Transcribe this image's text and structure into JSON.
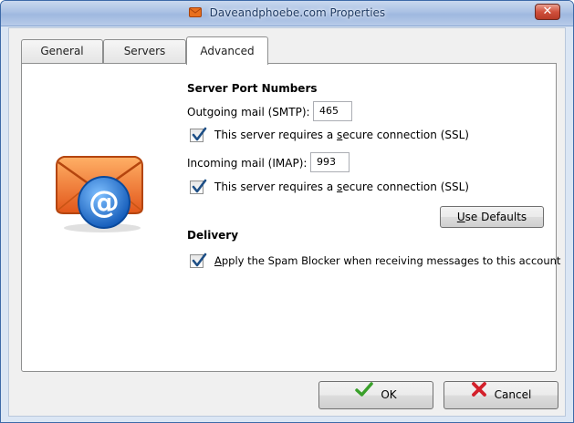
{
  "window": {
    "title": "Daveandphoebe.com Properties",
    "close_glyph": "✕"
  },
  "tabs": [
    {
      "label": "General",
      "active": false
    },
    {
      "label": "Servers",
      "active": false
    },
    {
      "label": "Advanced",
      "active": true
    }
  ],
  "server_ports": {
    "heading": "Server Port Numbers",
    "outgoing": {
      "label": "Outgoing mail (SMTP):",
      "value": "465",
      "ssl_pre": "This server requires a ",
      "ssl_key": "s",
      "ssl_post": "ecure connection (SSL)",
      "ssl_checked": true
    },
    "incoming": {
      "label": "Incoming mail (IMAP):",
      "value": "993",
      "ssl_pre": "This server requires a ",
      "ssl_key": "s",
      "ssl_post": "ecure connection (SSL)",
      "ssl_checked": true
    },
    "defaults_button": {
      "key": "U",
      "rest": "se Defaults"
    }
  },
  "delivery": {
    "heading": "Delivery",
    "spam_key": "A",
    "spam_rest": "pply the Spam Blocker when receiving messages to this account",
    "spam_checked": true
  },
  "footer": {
    "ok_label": "OK",
    "cancel_label": "Cancel"
  },
  "icons": {
    "title": "envelope-icon",
    "main": "mail-at-icon",
    "ok": "green-check-icon",
    "cancel": "red-x-icon"
  },
  "colors": {
    "checkmark": "#1e4f86",
    "ok_green": "#3aa02b",
    "cancel_red": "#d3202b",
    "envelope_orange": "#e8701e",
    "at_blue": "#1f6fd0"
  }
}
